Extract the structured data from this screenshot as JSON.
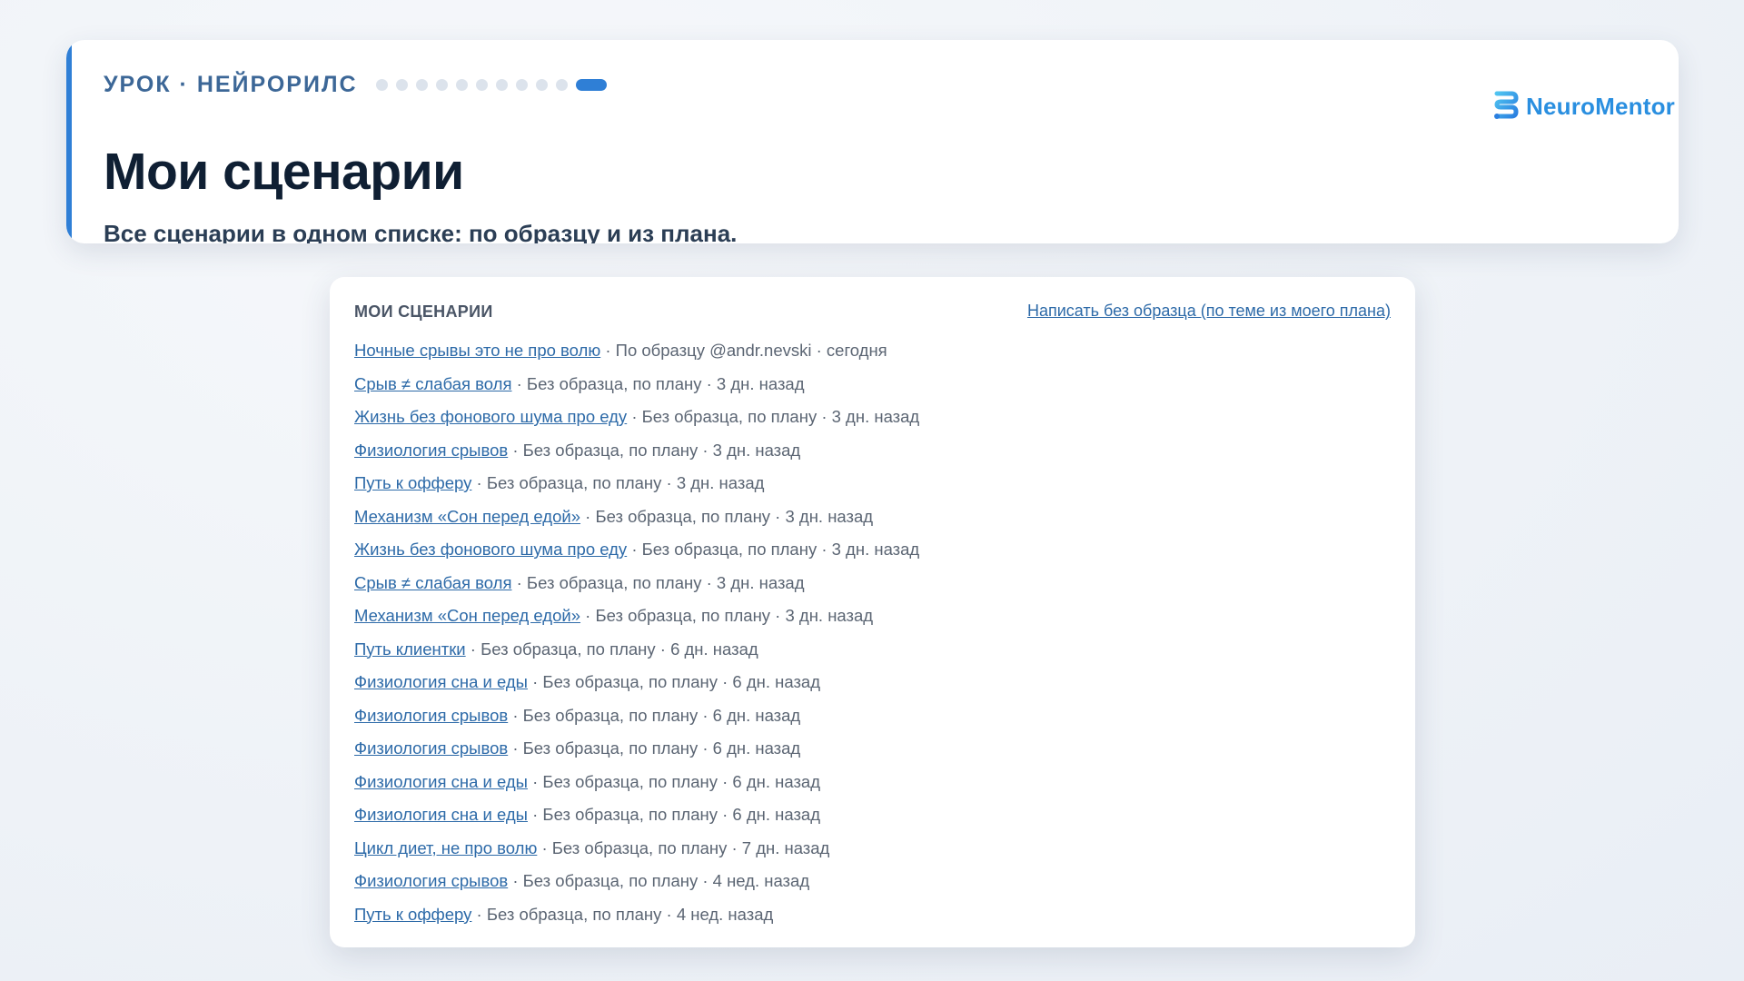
{
  "header": {
    "lesson_label": "УРОК · НЕЙРОРИЛС",
    "progress": {
      "total_steps": 11,
      "current_step": 11
    },
    "title": "Мои сценарии",
    "subtitle": "Все сценарии в одном списке: по образцу и из плана.",
    "brand_name": "NeuroMentor",
    "colors": {
      "accent": "#2f7fd6",
      "brand": "#2a8fe0"
    }
  },
  "scenarios": {
    "heading": "МОИ СЦЕНАРИИ",
    "new_link": "Написать без образца (по теме из моего плана)",
    "items": [
      {
        "title": "Ночные срывы это не про волю",
        "meta": " · По образцу @andr.nevski · сегодня"
      },
      {
        "title": "Срыв ≠ слабая воля",
        "meta": " · Без образца, по плану · 3 дн. назад"
      },
      {
        "title": "Жизнь без фонового шума про еду",
        "meta": " · Без образца, по плану · 3 дн. назад"
      },
      {
        "title": "Физиология срывов",
        "meta": " · Без образца, по плану · 3 дн. назад"
      },
      {
        "title": "Путь к офферу",
        "meta": " · Без образца, по плану · 3 дн. назад"
      },
      {
        "title": "Механизм «Сон перед едой»",
        "meta": " · Без образца, по плану · 3 дн. назад"
      },
      {
        "title": "Жизнь без фонового шума про еду",
        "meta": " · Без образца, по плану · 3 дн. назад"
      },
      {
        "title": "Срыв ≠ слабая воля",
        "meta": " · Без образца, по плану · 3 дн. назад"
      },
      {
        "title": "Механизм «Сон перед едой»",
        "meta": " · Без образца, по плану · 3 дн. назад"
      },
      {
        "title": "Путь клиентки",
        "meta": " · Без образца, по плану · 6 дн. назад"
      },
      {
        "title": "Физиология сна и еды",
        "meta": " · Без образца, по плану · 6 дн. назад"
      },
      {
        "title": "Физиология срывов",
        "meta": " · Без образца, по плану · 6 дн. назад"
      },
      {
        "title": "Физиология срывов",
        "meta": " · Без образца, по плану · 6 дн. назад"
      },
      {
        "title": "Физиология сна и еды",
        "meta": " · Без образца, по плану · 6 дн. назад"
      },
      {
        "title": "Физиология сна и еды",
        "meta": " · Без образца, по плану · 6 дн. назад"
      },
      {
        "title": "Цикл диет, не про волю",
        "meta": " · Без образца, по плану · 7 дн. назад"
      },
      {
        "title": "Физиология срывов",
        "meta": " · Без образца, по плану · 4 нед. назад"
      },
      {
        "title": "Путь к офферу",
        "meta": " · Без образца, по плану · 4 нед. назад"
      }
    ]
  }
}
